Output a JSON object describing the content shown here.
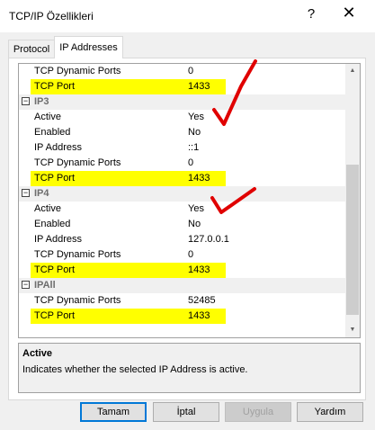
{
  "window": {
    "title": "TCP/IP Özellikleri",
    "help_glyph": "?",
    "close_glyph": "✕"
  },
  "tabs": [
    {
      "label": "Protocol",
      "selected": false
    },
    {
      "label": "IP Addresses",
      "selected": true
    }
  ],
  "grid": {
    "groups": [
      {
        "name": "",
        "rows": [
          {
            "key": "TCP Dynamic Ports",
            "value": "0",
            "highlighted": false
          },
          {
            "key": "TCP Port",
            "value": "1433",
            "highlighted": true
          }
        ]
      },
      {
        "name": "IP3",
        "rows": [
          {
            "key": "Active",
            "value": "Yes",
            "highlighted": false
          },
          {
            "key": "Enabled",
            "value": "No",
            "highlighted": false
          },
          {
            "key": "IP Address",
            "value": "::1",
            "highlighted": false
          },
          {
            "key": "TCP Dynamic Ports",
            "value": "0",
            "highlighted": false
          },
          {
            "key": "TCP Port",
            "value": "1433",
            "highlighted": true
          }
        ]
      },
      {
        "name": "IP4",
        "rows": [
          {
            "key": "Active",
            "value": "Yes",
            "highlighted": false
          },
          {
            "key": "Enabled",
            "value": "No",
            "highlighted": false
          },
          {
            "key": "IP Address",
            "value": "127.0.0.1",
            "highlighted": false
          },
          {
            "key": "TCP Dynamic Ports",
            "value": "0",
            "highlighted": false
          },
          {
            "key": "TCP Port",
            "value": "1433",
            "highlighted": true
          }
        ]
      },
      {
        "name": "IPAll",
        "rows": [
          {
            "key": "TCP Dynamic Ports",
            "value": "52485",
            "highlighted": false
          },
          {
            "key": "TCP Port",
            "value": "1433",
            "highlighted": true
          }
        ]
      }
    ],
    "collapse_glyph": "−",
    "scroll_up_glyph": "▲",
    "scroll_down_glyph": "▼"
  },
  "description": {
    "title": "Active",
    "text": "Indicates whether the selected IP Address is active."
  },
  "buttons": {
    "ok": "Tamam",
    "cancel": "İptal",
    "apply": "Uygula",
    "help": "Yardım"
  },
  "colors": {
    "highlight": "#ffff00",
    "annotation": "#e00000",
    "focus_border": "#0078d7"
  }
}
